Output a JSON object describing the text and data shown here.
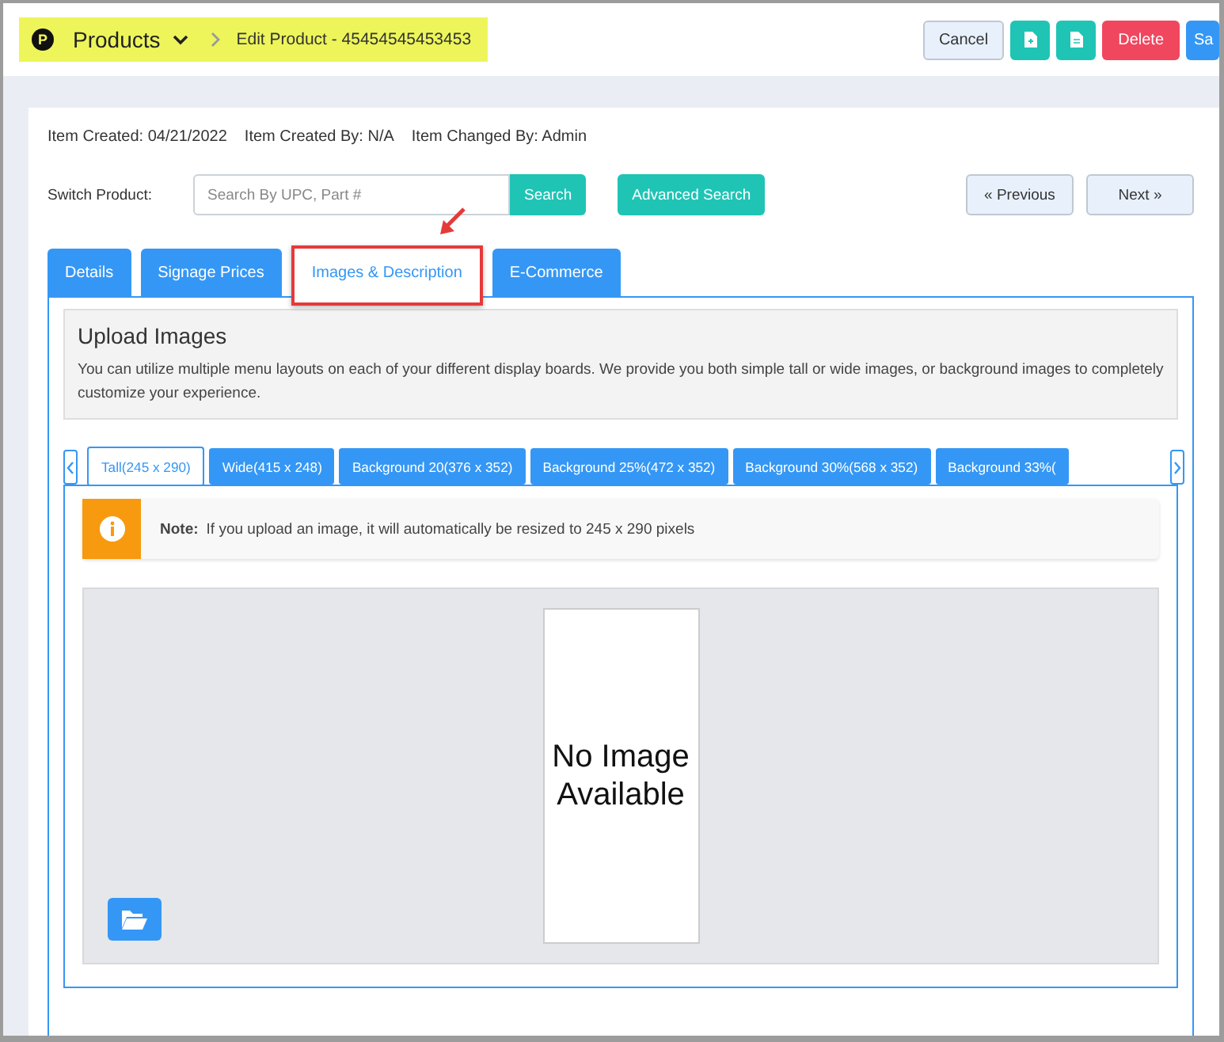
{
  "header": {
    "logo": "P",
    "title": "Products",
    "breadcrumb": "Edit Product - 45454545453453",
    "highlighted": true,
    "buttons": [
      {
        "kind": "cancel",
        "label": "Cancel"
      },
      {
        "kind": "add-file"
      },
      {
        "kind": "file"
      },
      {
        "kind": "delete",
        "label": "Delete"
      },
      {
        "kind": "save",
        "label": "Sa"
      }
    ]
  },
  "meta": [
    "Item Created: 04/21/2022",
    "Item Created By: N/A",
    "Item Changed By: Admin"
  ],
  "switch_product": {
    "label": "Switch Product:",
    "placeholder": "Search By UPC, Part #",
    "search_button": "Search",
    "advanced_button": "Advanced Search",
    "previous": "« Previous",
    "next": "Next »"
  },
  "tabs": [
    {
      "label": "Details",
      "selected": false,
      "annotated": false
    },
    {
      "label": "Signage Prices",
      "selected": false,
      "annotated": false
    },
    {
      "label": "Images & Description",
      "selected": true,
      "annotated": true
    },
    {
      "label": "E-Commerce",
      "selected": false,
      "annotated": false
    }
  ],
  "upload": {
    "title": "Upload Images",
    "description": "You can utilize multiple menu layouts on each of your different display boards. We provide you both simple tall or wide images, or background images to completely customize your experience."
  },
  "size_tabs": [
    {
      "label": "Tall(245 x 290)",
      "selected": true
    },
    {
      "label": "Wide(415 x 248)",
      "selected": false
    },
    {
      "label": "Background 20(376 x 352)",
      "selected": false
    },
    {
      "label": "Background 25%(472 x 352)",
      "selected": false
    },
    {
      "label": "Background 30%(568 x 352)",
      "selected": false
    },
    {
      "label": "Background 33%(",
      "selected": false
    }
  ],
  "note": {
    "label": "Note:",
    "text": "If you upload an image, it will automatically be resized to 245 x 290 pixels"
  },
  "preview": {
    "placeholder_text": "No Image Available"
  }
}
